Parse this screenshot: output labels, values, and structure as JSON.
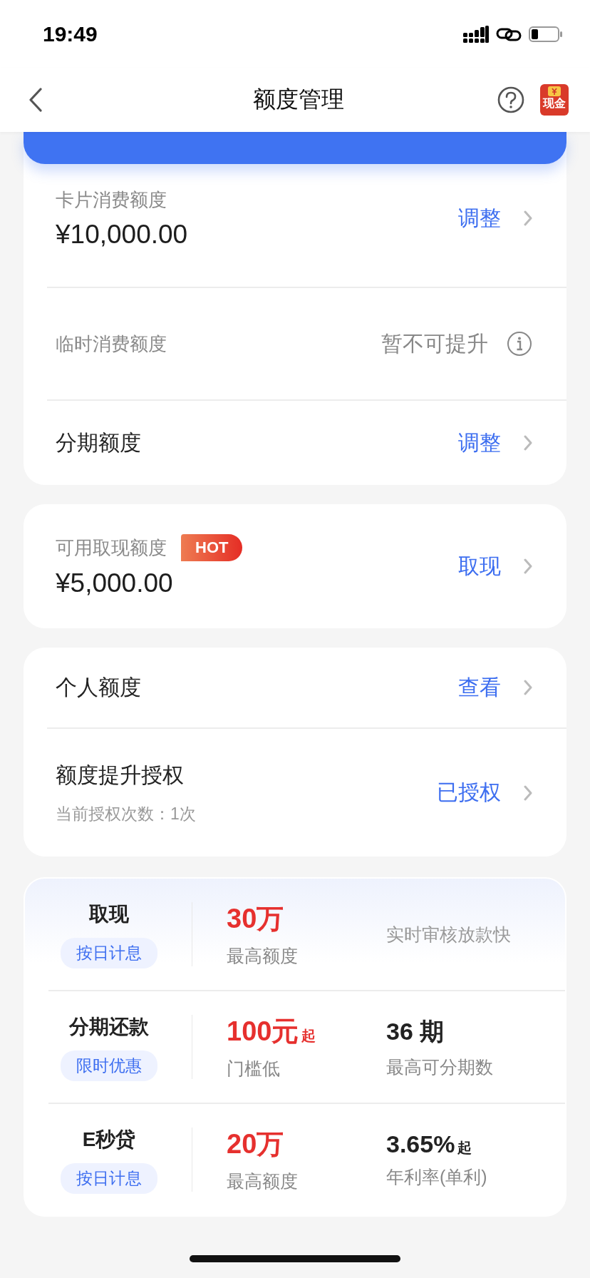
{
  "status_bar": {
    "time": "19:49"
  },
  "nav": {
    "title": "额度管理",
    "cash_badge": "现金"
  },
  "quota_card": {
    "items": [
      {
        "kind": "amount",
        "label": "卡片消费额度",
        "amount": "¥10,000.00",
        "action": "调整"
      },
      {
        "kind": "info",
        "label": "临时消费额度",
        "status": "暂不可提升"
      },
      {
        "kind": "plain",
        "label": "分期额度",
        "action": "调整"
      }
    ]
  },
  "cash_card": {
    "label": "可用取现额度",
    "badge": "HOT",
    "amount": "¥5,000.00",
    "action": "取现"
  },
  "other_card": {
    "items": [
      {
        "label": "个人额度",
        "action": "查看"
      },
      {
        "label": "额度提升授权",
        "sublabel": "当前授权次数：1次",
        "action": "已授权"
      }
    ]
  },
  "products": [
    {
      "name": "取现",
      "tag": "按日计息",
      "value": "30万",
      "caption": "最高额度",
      "detail": {
        "kind": "note",
        "text": "实时审核放款快"
      }
    },
    {
      "name": "分期还款",
      "tag": "限时优惠",
      "value": "100元",
      "value_suffix": "起",
      "caption": "门槛低",
      "detail": {
        "kind": "stat",
        "value": "36 期",
        "caption": "最高可分期数"
      }
    },
    {
      "name": "E秒贷",
      "tag": "按日计息",
      "value": "20万",
      "caption": "最高额度",
      "detail": {
        "kind": "stat",
        "value": "3.65%",
        "suffix": "起",
        "caption": "年利率(单利)"
      }
    }
  ]
}
